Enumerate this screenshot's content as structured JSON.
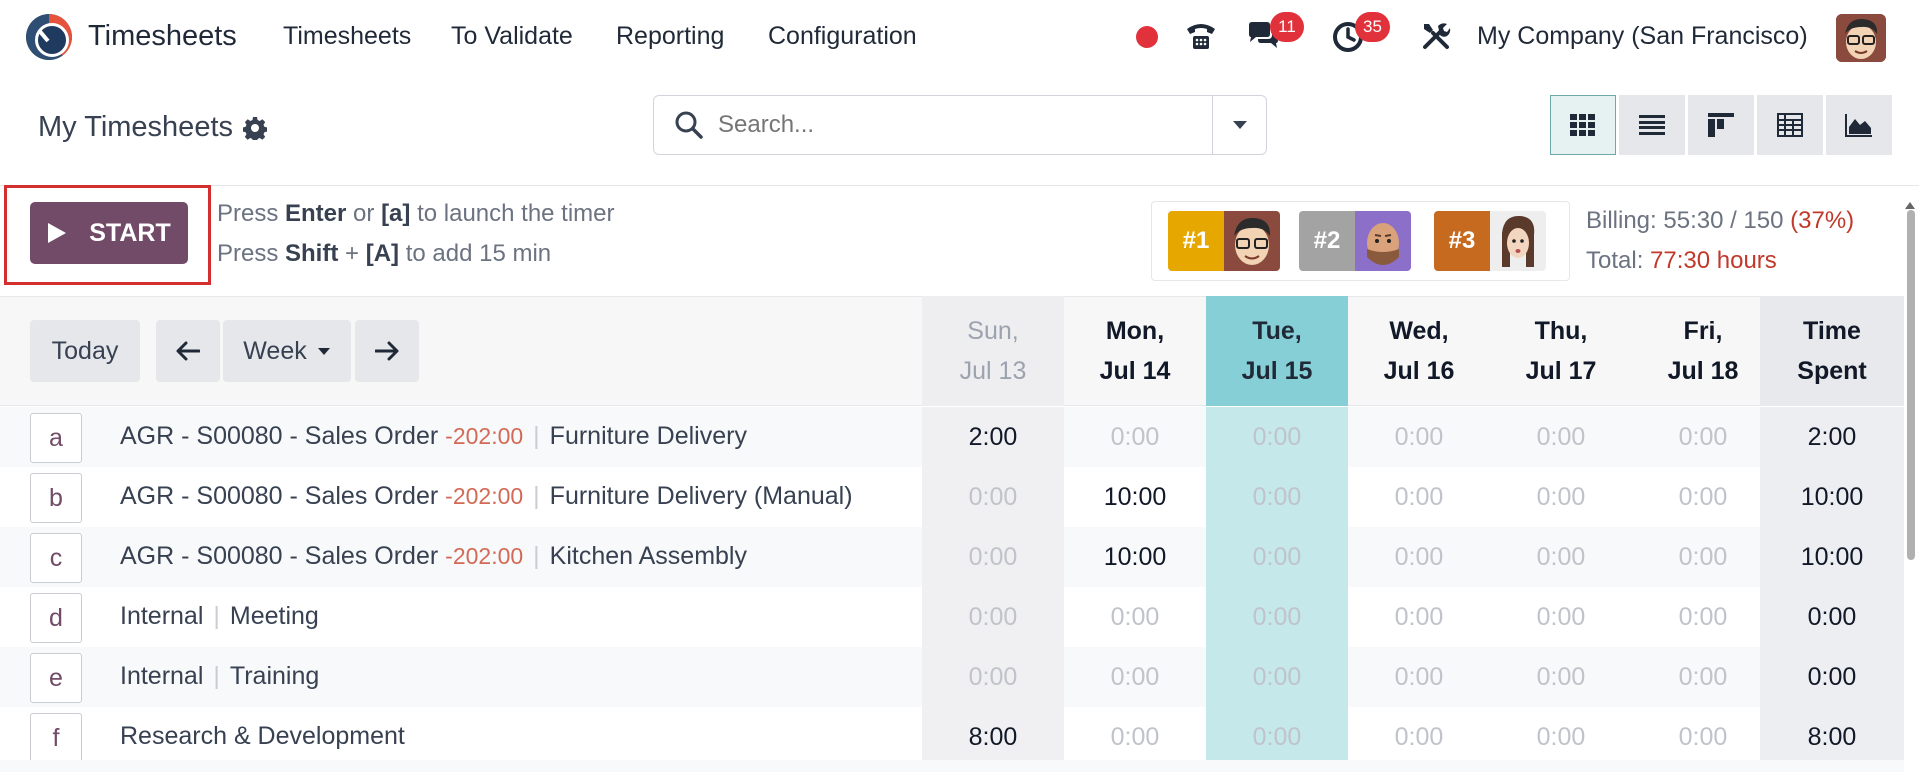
{
  "navbar": {
    "app_title": "Timesheets",
    "menu": [
      "Timesheets",
      "To Validate",
      "Reporting",
      "Configuration"
    ],
    "chat_count": "11",
    "activity_count": "35",
    "company": "My Company (San Francisco)"
  },
  "control": {
    "page_title": "My Timesheets",
    "search_placeholder": "Search..."
  },
  "timer": {
    "start_label": "START",
    "hint1": {
      "a": "Press ",
      "b": "Enter",
      "c": " or ",
      "d": "[a]",
      "e": " to launch the timer"
    },
    "hint2": {
      "a": "Press ",
      "b": "Shift",
      "c": " + ",
      "d": "[A]",
      "e": " to add 15 min"
    },
    "ranks": [
      "#1",
      "#2",
      "#3"
    ],
    "rank_colors": [
      "#e6a700",
      "#a3a3a3",
      "#c66a1f"
    ],
    "billing_label": "Billing: 55:30 / 150 ",
    "billing_pct": "(37%)",
    "total_label": "Total: ",
    "total_value": "77:30 hours"
  },
  "grid": {
    "today_btn": "Today",
    "prev_icon": "arrow-left-icon",
    "period": "Week",
    "next_icon": "arrow-right-icon",
    "columns": [
      {
        "d": "Sun,",
        "m": "Jul 13"
      },
      {
        "d": "Mon,",
        "m": "Jul 14"
      },
      {
        "d": "Tue,",
        "m": "Jul 15"
      },
      {
        "d": "Wed,",
        "m": "Jul 16"
      },
      {
        "d": "Thu,",
        "m": "Jul 17"
      },
      {
        "d": "Fri,",
        "m": "Jul 18"
      }
    ],
    "total_col": {
      "a": "Time",
      "b": "Spent"
    },
    "rows": [
      {
        "key": "a",
        "project": "AGR - S00080 - Sales Order",
        "neg": "-202:00",
        "task": "Furniture Delivery",
        "values": [
          "2:00",
          "0:00",
          "0:00",
          "0:00",
          "0:00",
          "0:00"
        ],
        "total": "2:00"
      },
      {
        "key": "b",
        "project": "AGR - S00080 - Sales Order",
        "neg": "-202:00",
        "task": "Furniture Delivery (Manual)",
        "values": [
          "0:00",
          "10:00",
          "0:00",
          "0:00",
          "0:00",
          "0:00"
        ],
        "total": "10:00"
      },
      {
        "key": "c",
        "project": "AGR - S00080 - Sales Order",
        "neg": "-202:00",
        "task": "Kitchen Assembly",
        "values": [
          "0:00",
          "10:00",
          "0:00",
          "0:00",
          "0:00",
          "0:00"
        ],
        "total": "10:00"
      },
      {
        "key": "d",
        "project": "Internal",
        "neg": "",
        "task": "Meeting",
        "values": [
          "0:00",
          "0:00",
          "0:00",
          "0:00",
          "0:00",
          "0:00"
        ],
        "total": "0:00"
      },
      {
        "key": "e",
        "project": "Internal",
        "neg": "",
        "task": "Training",
        "values": [
          "0:00",
          "0:00",
          "0:00",
          "0:00",
          "0:00",
          "0:00"
        ],
        "total": "0:00"
      },
      {
        "key": "f",
        "project": "Research & Development",
        "neg": "",
        "task": "",
        "values": [
          "8:00",
          "0:00",
          "0:00",
          "0:00",
          "0:00",
          "0:00"
        ],
        "total": "8:00"
      }
    ]
  }
}
